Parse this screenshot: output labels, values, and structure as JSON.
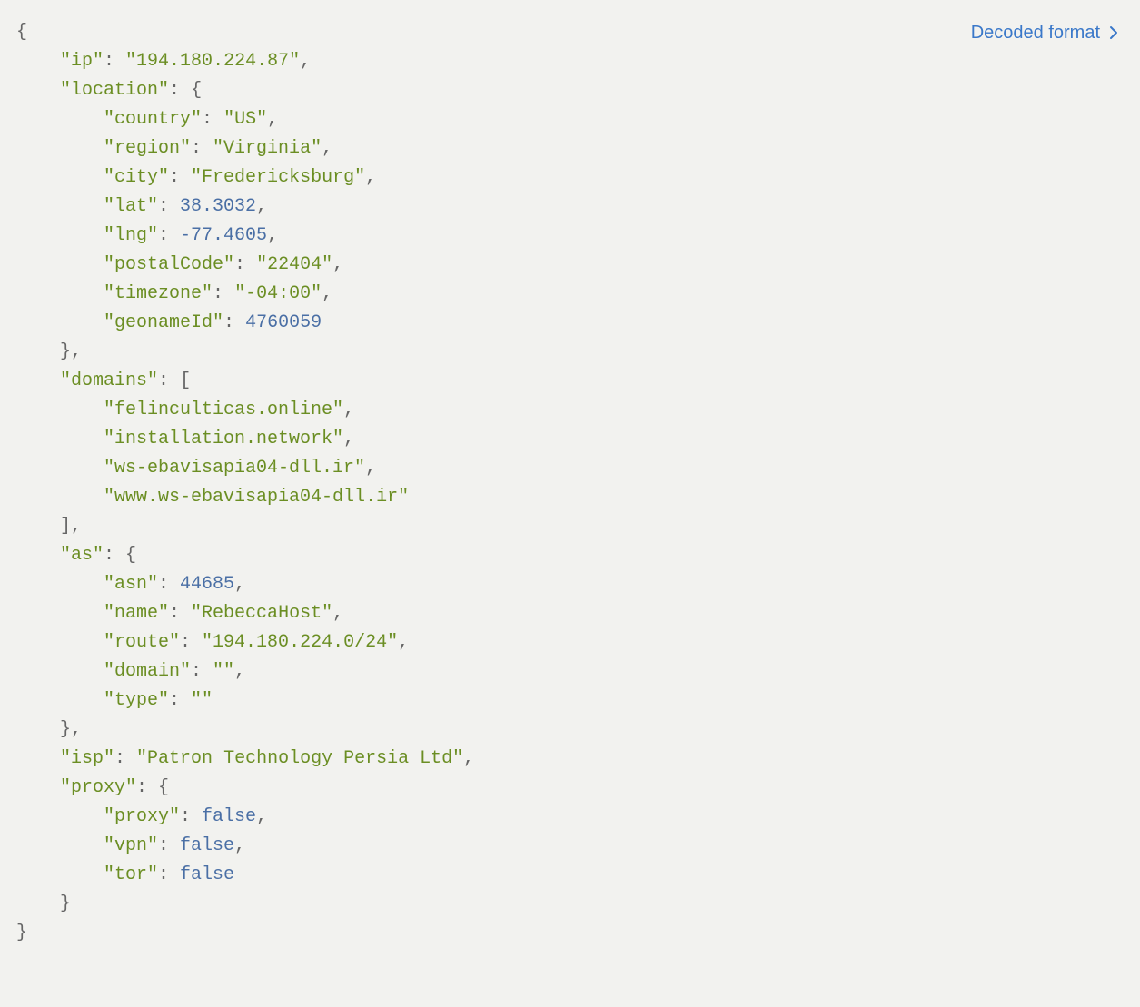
{
  "link": {
    "label": "Decoded format"
  },
  "indent_unit": "    ",
  "json": {
    "ip": "194.180.224.87",
    "location": {
      "country": "US",
      "region": "Virginia",
      "city": "Fredericksburg",
      "lat": 38.3032,
      "lng": -77.4605,
      "postalCode": "22404",
      "timezone": "-04:00",
      "geonameId": 4760059
    },
    "domains": [
      "felinculticas.online",
      "installation.network",
      "ws-ebavisapia04-dll.ir",
      "www.ws-ebavisapia04-dll.ir"
    ],
    "as": {
      "asn": 44685,
      "name": "RebeccaHost",
      "route": "194.180.224.0/24",
      "domain": "",
      "type": ""
    },
    "isp": "Patron Technology Persia Ltd",
    "proxy": {
      "proxy": false,
      "vpn": false,
      "tor": false
    }
  }
}
